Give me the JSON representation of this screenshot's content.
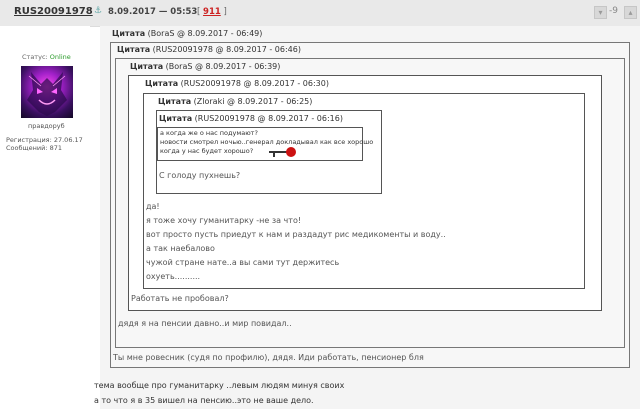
{
  "post": {
    "username": "RUS20091978",
    "date": "8.09.2017 — 05:53",
    "number_prefix": "[ ",
    "number": "911",
    "number_suffix": " ]",
    "rating": "-9",
    "anchor_icon": "anchor-icon"
  },
  "user": {
    "status_label": "Статус: ",
    "status_value": "Online",
    "rank": "правдоруб",
    "registration": "Регистрация: 27.06.17",
    "messages": "Сообщений: 871"
  },
  "quotes": [
    {
      "label": "Цитата",
      "meta": " (BoraS @ 8.09.2017 - 06:49)"
    },
    {
      "label": "Цитата",
      "meta": " (RUS20091978 @ 8.09.2017 - 06:46)"
    },
    {
      "label": "Цитата",
      "meta": " (BoraS @ 8.09.2017 - 06:39)"
    },
    {
      "label": "Цитата",
      "meta": " (RUS20091978 @ 8.09.2017 - 06:30)"
    },
    {
      "label": "Цитата",
      "meta": " (Zloraki @ 8.09.2017 - 06:25)"
    },
    {
      "label": "Цитата",
      "meta": " (RUS20091978 @ 8.09.2017 - 06:16)"
    }
  ],
  "innermost_lines": [
    "а когда же о нас подумают?",
    "новости смотрел ночью..генерал докладывал как все хорошо",
    "когда у нас будет хорошо?"
  ],
  "reply_5": "С голоду пухнешь?",
  "reply_4_lines": [
    "да!",
    "я тоже хочу гуманитарку -не за что!",
    "вот просто пусть приедут к нам и раздадут рис медикоменты и воду..",
    "а так наебалово",
    "чужой стране нате..а вы сами тут держитесь",
    "охуеть.........."
  ],
  "reply_3": "Работать не пробовал?",
  "reply_2": "дядя я на пенсии давно..и мир повидал..",
  "reply_1": "Ты мне ровесник (судя по профилю), дядя. Иди работать, пенсионер бля",
  "body_lines": [
    "тема вообще про гуманитарку ..левым людям минуя своих",
    "а то что я в 35 вишел на пенсию..это не ваше дело."
  ]
}
